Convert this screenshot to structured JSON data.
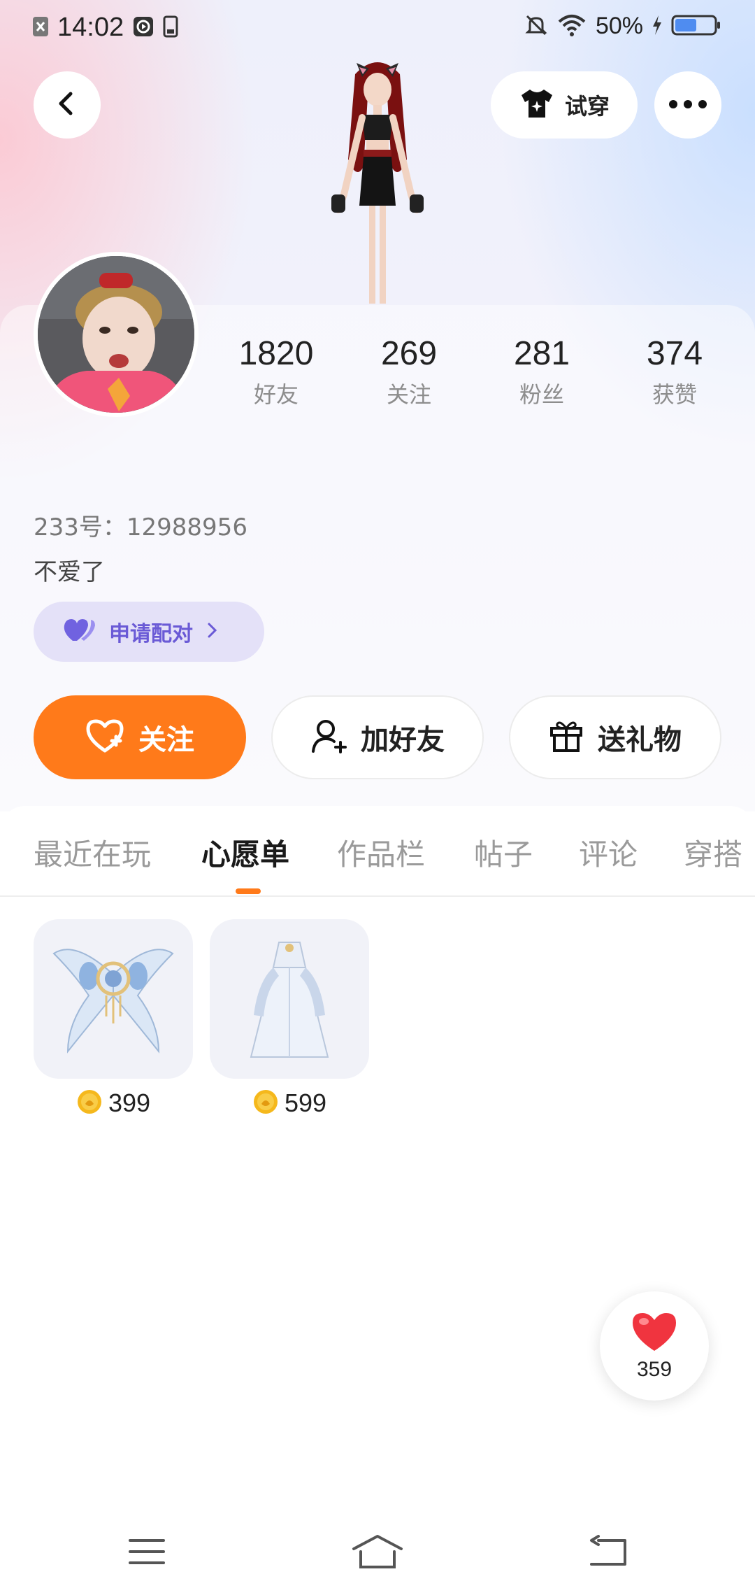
{
  "status_bar": {
    "time": "14:02",
    "battery_percent": "50%",
    "icons": [
      "close-notification-icon",
      "media-icon",
      "phone-icon",
      "mute-bell-icon",
      "wifi-icon",
      "charging-icon",
      "battery-icon"
    ]
  },
  "header": {
    "back_icon": "chevron-left-icon",
    "try_on_label": "试穿",
    "try_on_icon": "tshirt-icon",
    "more_icon": "more-dots-icon"
  },
  "profile": {
    "stats": [
      {
        "value": "1820",
        "label": "好友"
      },
      {
        "value": "269",
        "label": "关注"
      },
      {
        "value": "281",
        "label": "粉丝"
      },
      {
        "value": "374",
        "label": "获赞"
      }
    ],
    "uid": "233号：12988956",
    "bio": "不爱了",
    "match_label": "申请配对"
  },
  "actions": {
    "follow": "关注",
    "add_friend": "加好友",
    "send_gift": "送礼物"
  },
  "tabs": [
    {
      "label": "最近在玩",
      "active": false
    },
    {
      "label": "心愿单",
      "active": true
    },
    {
      "label": "作品栏",
      "active": false
    },
    {
      "label": "帖子",
      "active": false
    },
    {
      "label": "评论",
      "active": false
    },
    {
      "label": "穿搭",
      "active": false
    }
  ],
  "wishlist": [
    {
      "name": "wing-accessory",
      "price": "399"
    },
    {
      "name": "white-gown",
      "price": "599"
    }
  ],
  "like_fab": {
    "count": "359"
  },
  "colors": {
    "accent": "#ff7a1a",
    "match_purple": "#6a5ad6",
    "heart_red": "#f0343f"
  }
}
